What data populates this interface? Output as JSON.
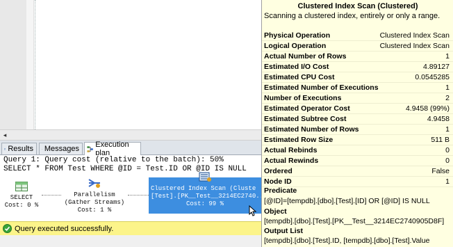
{
  "tabs": [
    {
      "label": "Results",
      "icon": "results-grid-icon"
    },
    {
      "label": "Messages",
      "icon": "messages-icon"
    },
    {
      "label": "Execution plan",
      "icon": "execution-plan-icon"
    }
  ],
  "results": {
    "query_line1": "Query 1: Query cost (relative to the batch): 50%",
    "query_line2": "SELECT * FROM Test WHERE @ID = Test.ID OR @ID IS NULL"
  },
  "plan": {
    "select": {
      "line1": "SELECT",
      "line2": "Cost: 0 %"
    },
    "parallelism": {
      "line1": "Parallelism",
      "line2": "(Gather Streams)",
      "line3": "Cost: 1 %"
    },
    "clustered_scan": {
      "line1": "Clustered Index Scan (Cluste",
      "line2": "[Test].[PK__Test__3214EC2740...",
      "line3": "Cost: 99 %"
    }
  },
  "status": {
    "text": "Query executed successfully.",
    "icon": "success-check-icon",
    "color": "#fcf48a"
  },
  "tooltip": {
    "title": "Clustered Index Scan (Clustered)",
    "description": "Scanning a clustered index, entirely or only a range.",
    "properties": [
      {
        "key": "Physical Operation",
        "value": "Clustered Index Scan"
      },
      {
        "key": "Logical Operation",
        "value": "Clustered Index Scan"
      },
      {
        "key": "Actual Number of Rows",
        "value": "1"
      },
      {
        "key": "Estimated I/O Cost",
        "value": "4.89127"
      },
      {
        "key": "Estimated CPU Cost",
        "value": "0.0545285"
      },
      {
        "key": "Estimated Number of Executions",
        "value": "1"
      },
      {
        "key": "Number of Executions",
        "value": "2"
      },
      {
        "key": "Estimated Operator Cost",
        "value": "4.9458 (99%)"
      },
      {
        "key": "Estimated Subtree Cost",
        "value": "4.9458"
      },
      {
        "key": "Estimated Number of Rows",
        "value": "1"
      },
      {
        "key": "Estimated Row Size",
        "value": "511 B"
      },
      {
        "key": "Actual Rebinds",
        "value": "0"
      },
      {
        "key": "Actual Rewinds",
        "value": "0"
      },
      {
        "key": "Ordered",
        "value": "False"
      },
      {
        "key": "Node ID",
        "value": "1"
      }
    ],
    "predicate_label": "Predicate",
    "predicate_value": "[@ID]=[tempdb].[dbo].[Test].[ID] OR [@ID] IS NULL",
    "object_label": "Object",
    "object_value": "[tempdb].[dbo].[Test].[PK__Test__3214EC2740905D8F]",
    "output_label": "Output List",
    "output_value": "[tempdb].[dbo].[Test].ID, [tempdb].[dbo].[Test].Value"
  }
}
